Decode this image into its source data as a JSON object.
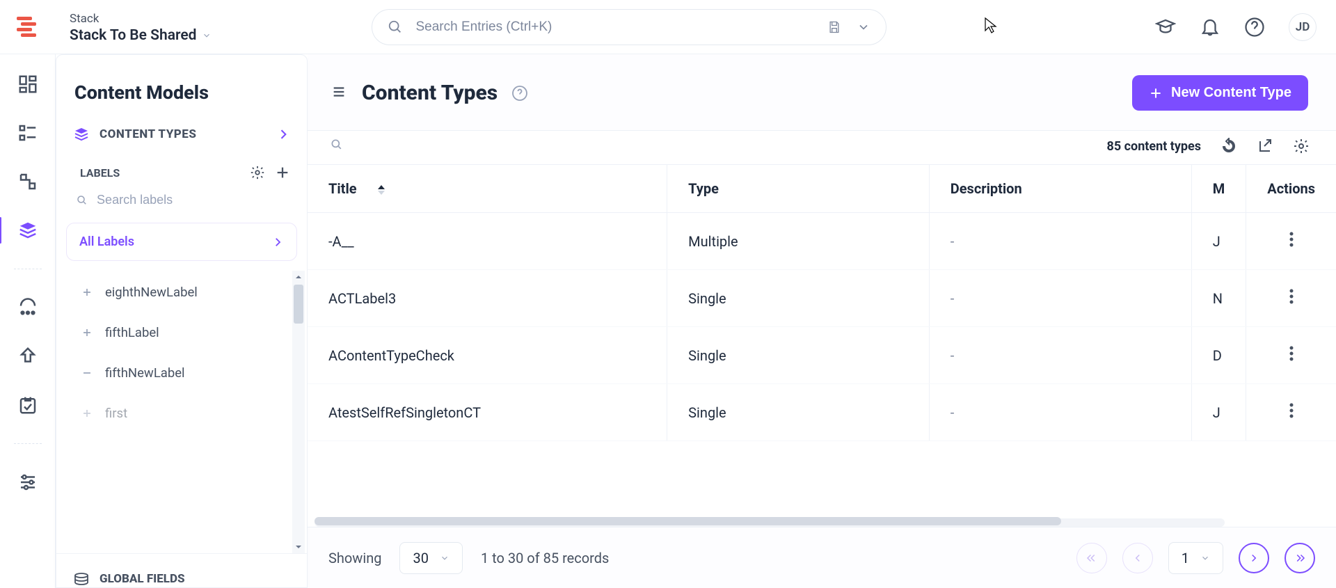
{
  "header": {
    "stack_label": "Stack",
    "stack_name": "Stack To Be Shared",
    "search_placeholder": "Search Entries (Ctrl+K)",
    "avatar": "JD"
  },
  "sidebar": {
    "title": "Content Models",
    "section_ct": "CONTENT TYPES",
    "labels_head": "LABELS",
    "search_labels_placeholder": "Search labels",
    "all_labels": "All Labels",
    "labels": [
      {
        "name": "eighthNewLabel",
        "expandable": true
      },
      {
        "name": "fifthLabel",
        "expandable": true
      },
      {
        "name": "fifthNewLabel",
        "expandable": false
      },
      {
        "name": "first",
        "expandable": true
      }
    ],
    "global_fields": "GLOBAL FIELDS"
  },
  "main": {
    "title": "Content Types",
    "new_btn": "New Content Type",
    "count_text": "85 content types",
    "columns": {
      "title": "Title",
      "type": "Type",
      "desc": "Description",
      "m": "M",
      "actions": "Actions"
    },
    "rows": [
      {
        "title": "-A__",
        "type": "Multiple",
        "desc": "-",
        "m": "J"
      },
      {
        "title": "ACTLabel3",
        "type": "Single",
        "desc": "-",
        "m": "N"
      },
      {
        "title": "AContentTypeCheck",
        "type": "Single",
        "desc": "-",
        "m": "D"
      },
      {
        "title": "AtestSelfRefSingletonCT",
        "type": "Single",
        "desc": "-",
        "m": "J"
      }
    ],
    "footer": {
      "showing": "Showing",
      "page_size": "30",
      "records": "1 to 30 of 85 records",
      "page": "1"
    }
  }
}
